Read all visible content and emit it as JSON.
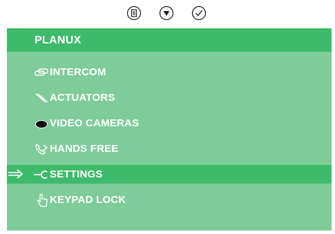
{
  "toolbar": {
    "icons": [
      "menu-icon",
      "down-arrow-icon",
      "checkmark-icon"
    ]
  },
  "header": {
    "title": "PLANUX"
  },
  "menu": {
    "selected_index": 4,
    "items": [
      {
        "label": "INTERCOM",
        "icon": "intercom-icon"
      },
      {
        "label": "ACTUATORS",
        "icon": "actuator-icon"
      },
      {
        "label": "VIDEO CAMERAS",
        "icon": "camera-eye-icon"
      },
      {
        "label": "HANDS FREE",
        "icon": "handsfree-phone-icon"
      },
      {
        "label": "SETTINGS",
        "icon": "wrench-icon"
      },
      {
        "label": "KEYPAD LOCK",
        "icon": "hand-pointer-icon"
      }
    ]
  },
  "colors": {
    "screen_bg": "#7fcc9a",
    "highlight": "#3dbb6a",
    "text": "#ffffff"
  }
}
